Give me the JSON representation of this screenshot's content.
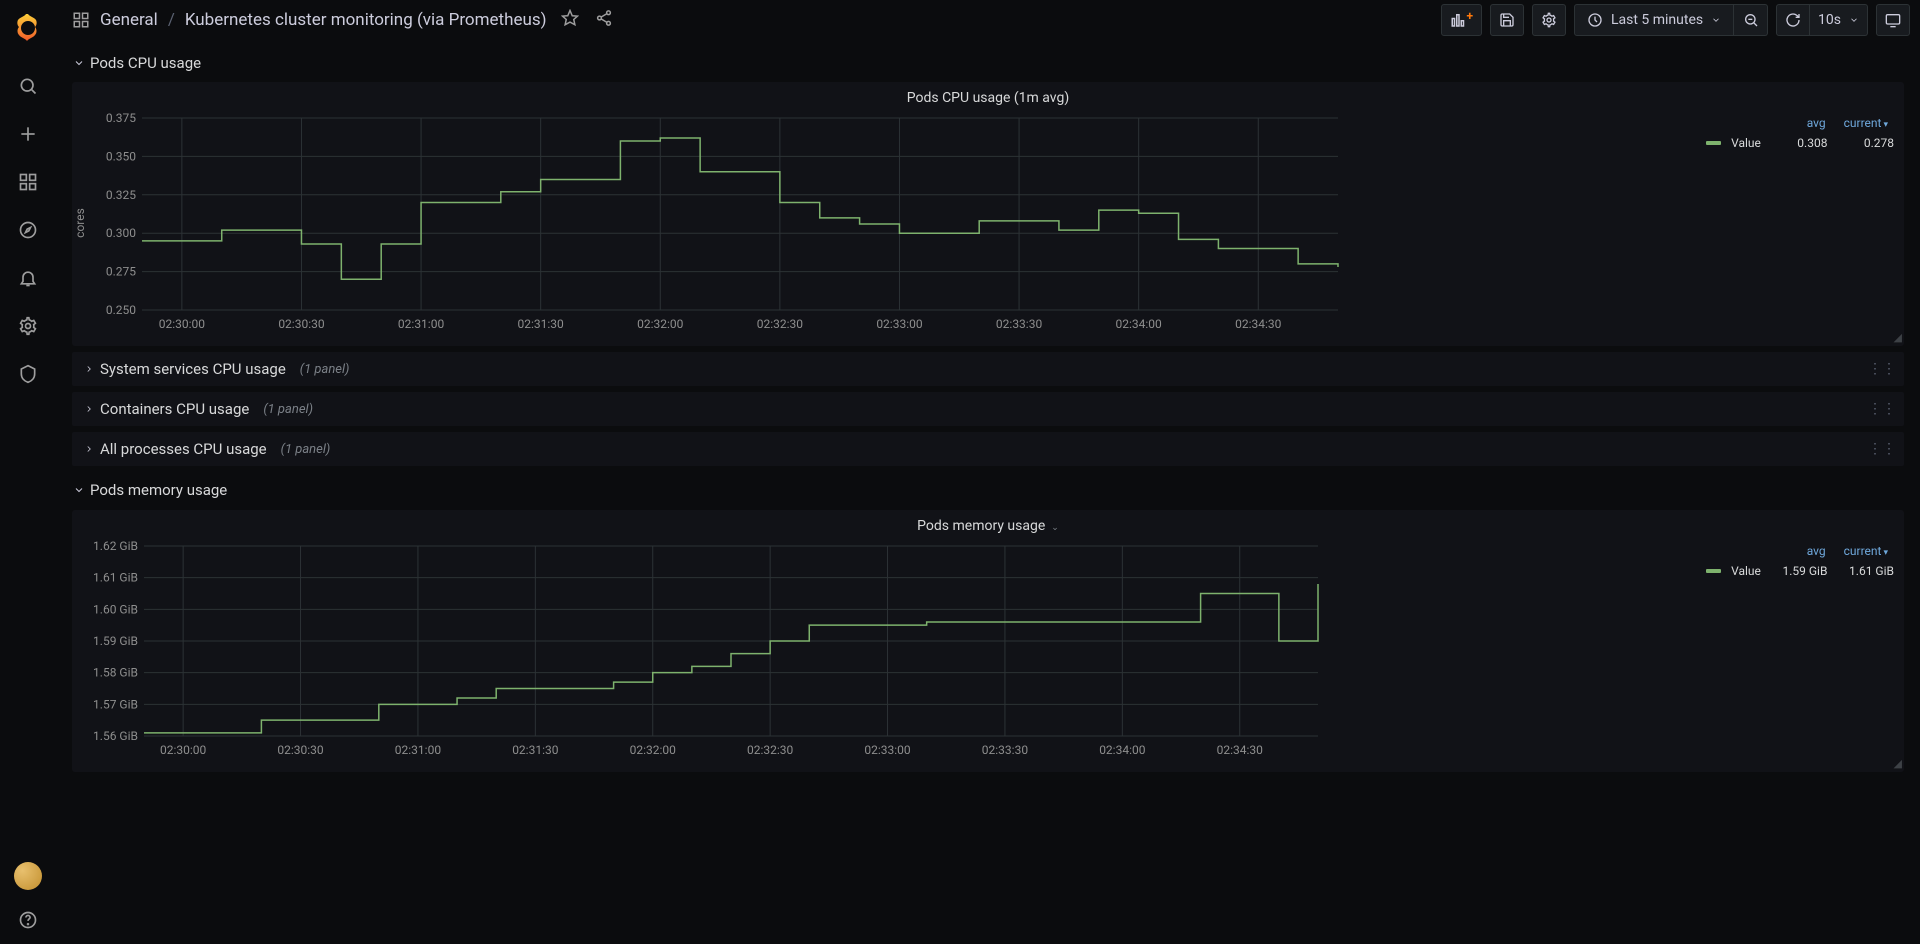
{
  "breadcrumb": {
    "folder": "General",
    "dashboard": "Kubernetes cluster monitoring (via Prometheus)"
  },
  "toolbar": {
    "time_range": "Last 5 minutes",
    "refresh_interval": "10s"
  },
  "rows": {
    "pods_cpu": {
      "title": "Pods CPU usage"
    },
    "sys_cpu": {
      "title": "System services CPU usage",
      "count": "(1 panel)"
    },
    "cont_cpu": {
      "title": "Containers CPU usage",
      "count": "(1 panel)"
    },
    "all_cpu": {
      "title": "All processes CPU usage",
      "count": "(1 panel)"
    },
    "pods_mem": {
      "title": "Pods memory usage"
    }
  },
  "legend_cols": {
    "avg": "avg",
    "current": "current"
  },
  "panel_cpu": {
    "title": "Pods CPU usage (1m avg)",
    "ylabel": "cores",
    "series_name": "Value",
    "avg": "0.308",
    "current": "0.278"
  },
  "panel_mem": {
    "title": "Pods memory usage",
    "series_name": "Value",
    "avg": "1.59 GiB",
    "current": "1.61 GiB"
  },
  "chart_data": [
    {
      "type": "line",
      "title": "Pods CPU usage (1m avg)",
      "xlabel": "",
      "ylabel": "cores",
      "ylim": [
        0.25,
        0.375
      ],
      "x_ticks": [
        "02:30:00",
        "02:30:30",
        "02:31:00",
        "02:31:30",
        "02:32:00",
        "02:32:30",
        "02:33:00",
        "02:33:30",
        "02:34:00",
        "02:34:30"
      ],
      "y_ticks": [
        0.25,
        0.275,
        0.3,
        0.325,
        0.35,
        0.375
      ],
      "series": [
        {
          "name": "Value",
          "x": [
            "02:29:50",
            "02:30:00",
            "02:30:10",
            "02:30:20",
            "02:30:30",
            "02:30:40",
            "02:30:50",
            "02:31:00",
            "02:31:10",
            "02:31:20",
            "02:31:30",
            "02:31:40",
            "02:31:50",
            "02:32:00",
            "02:32:10",
            "02:32:20",
            "02:32:30",
            "02:32:40",
            "02:32:50",
            "02:33:00",
            "02:33:10",
            "02:33:20",
            "02:33:30",
            "02:33:40",
            "02:33:50",
            "02:34:00",
            "02:34:10",
            "02:34:20",
            "02:34:30",
            "02:34:40",
            "02:34:50"
          ],
          "values": [
            0.295,
            0.295,
            0.302,
            0.302,
            0.293,
            0.27,
            0.293,
            0.32,
            0.32,
            0.327,
            0.335,
            0.335,
            0.36,
            0.362,
            0.34,
            0.34,
            0.32,
            0.31,
            0.306,
            0.3,
            0.3,
            0.308,
            0.308,
            0.302,
            0.315,
            0.313,
            0.296,
            0.29,
            0.29,
            0.28,
            0.278
          ]
        }
      ]
    },
    {
      "type": "line",
      "title": "Pods memory usage",
      "xlabel": "",
      "ylabel": "GiB",
      "ylim": [
        1.56,
        1.62
      ],
      "x_ticks": [
        "02:30:00",
        "02:30:30",
        "02:31:00",
        "02:31:30",
        "02:32:00",
        "02:32:30",
        "02:33:00",
        "02:33:30",
        "02:34:00",
        "02:34:30"
      ],
      "y_ticks": [
        1.56,
        1.57,
        1.58,
        1.59,
        1.6,
        1.61,
        1.62
      ],
      "y_tick_labels": [
        "1.56 GiB",
        "1.57 GiB",
        "1.58 GiB",
        "1.59 GiB",
        "1.60 GiB",
        "1.61 GiB",
        "1.62 GiB"
      ],
      "series": [
        {
          "name": "Value",
          "x": [
            "02:29:50",
            "02:30:00",
            "02:30:10",
            "02:30:20",
            "02:30:30",
            "02:30:40",
            "02:30:50",
            "02:31:00",
            "02:31:10",
            "02:31:20",
            "02:31:30",
            "02:31:40",
            "02:31:50",
            "02:32:00",
            "02:32:10",
            "02:32:20",
            "02:32:30",
            "02:32:40",
            "02:32:50",
            "02:33:00",
            "02:33:10",
            "02:33:20",
            "02:33:30",
            "02:33:40",
            "02:33:50",
            "02:34:00",
            "02:34:10",
            "02:34:20",
            "02:34:30",
            "02:34:40",
            "02:34:50"
          ],
          "values": [
            1.561,
            1.561,
            1.561,
            1.565,
            1.565,
            1.565,
            1.57,
            1.57,
            1.572,
            1.575,
            1.575,
            1.575,
            1.577,
            1.58,
            1.582,
            1.586,
            1.59,
            1.595,
            1.595,
            1.595,
            1.596,
            1.596,
            1.596,
            1.596,
            1.596,
            1.596,
            1.596,
            1.605,
            1.605,
            1.59,
            1.608
          ]
        }
      ]
    }
  ]
}
